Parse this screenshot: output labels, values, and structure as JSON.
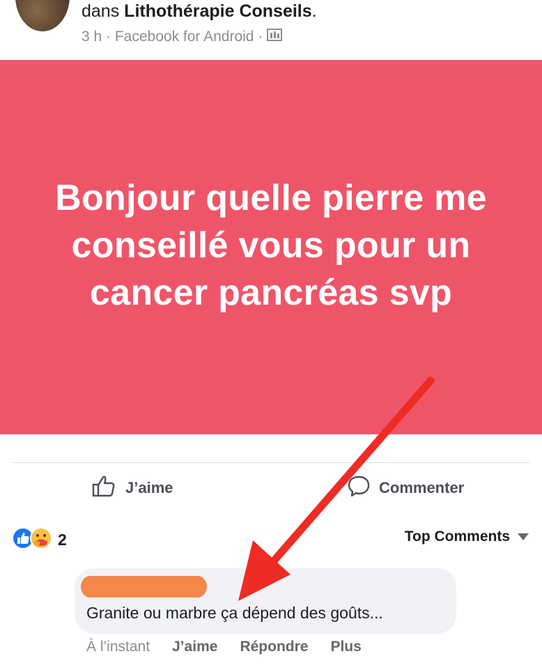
{
  "header": {
    "group_prefix": "dans ",
    "group_name": "Lithothérapie Conseils",
    "group_suffix": ".",
    "meta": "3 h · Facebook for Android ·",
    "privacy_icon": "group-members-icon"
  },
  "post": {
    "background_color": "#ef5569",
    "text_lines": [
      "Bonjour quelle pierre me",
      "conseillé vous pour un",
      "cancer pancréas svp"
    ]
  },
  "actions": {
    "like_label": "J’aime",
    "comment_label": "Commenter"
  },
  "reactions": {
    "icons": [
      "like-reaction-icon",
      "care-reaction-icon"
    ],
    "count": "2"
  },
  "comments_filter": {
    "label": "Top Comments",
    "icon": "caret-down-icon"
  },
  "comment": {
    "author_redacted_color": "#f4874a",
    "text": "Granite ou marbre ça dépend des goûts...",
    "time": "À l’instant",
    "like_label": "J’aime",
    "reply_label": "Répondre",
    "more_label": "Plus"
  },
  "annotation": {
    "arrow_color": "#ee2b24"
  }
}
